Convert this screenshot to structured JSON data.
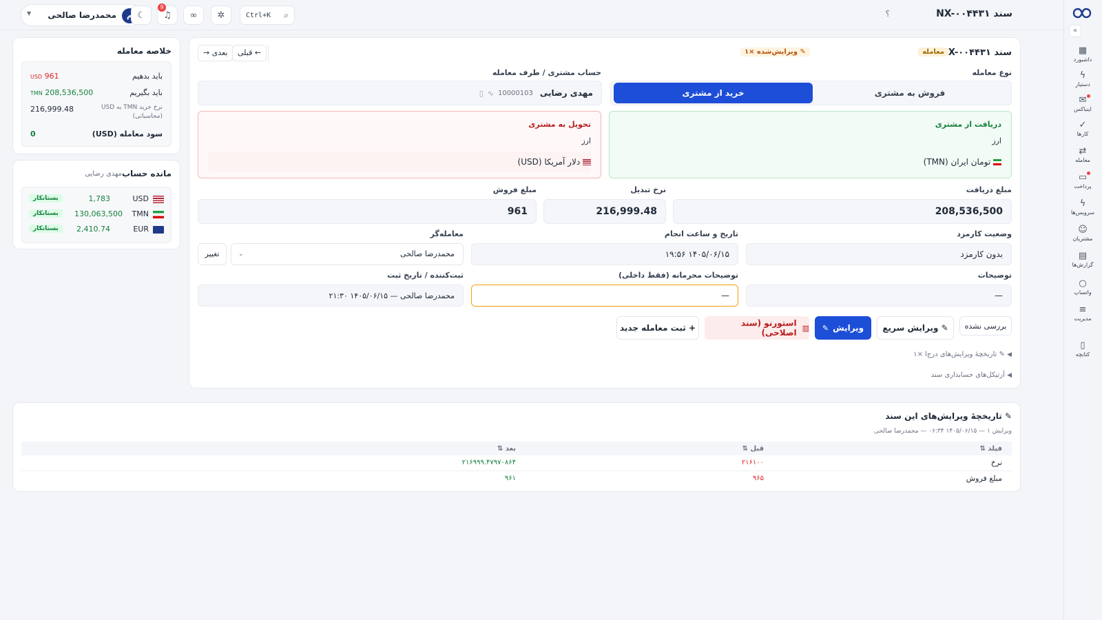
{
  "header": {
    "doc_title": "سند NX-۰۰۴۴۳۱",
    "help": "؟",
    "search_shortcut": "Ctrl+K",
    "notification_count": "9",
    "user_name": "محمدرضا صالحی",
    "user_initial": "م"
  },
  "sidebar": {
    "items": [
      {
        "label": "داشبورد",
        "icon": "▦"
      },
      {
        "label": "دستیار",
        "icon": "ϟ"
      },
      {
        "label": "اینباکس",
        "icon": "✉"
      },
      {
        "label": "کارها",
        "icon": "✓"
      },
      {
        "label": "معامله",
        "icon": "⇄"
      },
      {
        "label": "پرداخت",
        "icon": "▭"
      },
      {
        "label": "سرویس‌ها",
        "icon": "ϟ"
      },
      {
        "label": "مشتریان",
        "icon": "☺"
      },
      {
        "label": "گزارش‌ها",
        "icon": "▤"
      },
      {
        "label": "واتساپ",
        "icon": "○"
      },
      {
        "label": "مدیریت",
        "icon": "≡"
      },
      {
        "label": "کتابچه",
        "icon": "▯"
      }
    ]
  },
  "doc": {
    "title": "سند NX-۰۰۴۴۳۱",
    "type_badge": "معامله",
    "edited_badge": "✎ ویرایش‌شده ×۱",
    "prev": "← قبلی",
    "next": "بعدی →",
    "trade_type_label": "نوع معامله",
    "sell_label": "فروش به مشتری",
    "buy_label": "خرید از مشتری",
    "account_label": "حساب مشتری / طرف معامله",
    "account_name": "مهدی رضایی",
    "account_id": "10000103",
    "receive_title": "دریافت از مشتری",
    "receive_currency_label": "ارز",
    "receive_currency": "تومان ایران (TMN)",
    "deliver_title": "تحویل به مشتری",
    "deliver_currency_label": "ارز",
    "deliver_currency": "دلار آمریکا (USD)",
    "receive_amount_label": "مبلغ دریافت",
    "receive_amount": "208,536,500",
    "rate_label": "نرخ تبدیل",
    "rate": "216,999.48",
    "sell_amount_label": "مبلغ فروش",
    "sell_amount": "961",
    "fee_label": "وضعیت کارمزد",
    "fee": "بدون کارمزد",
    "datetime_label": "تاریخ و ساعت انجام",
    "datetime": "۱۴۰۵/۰۶/۱۵ ۱۹:۵۶",
    "dealer_label": "معامله‌گر",
    "dealer": "محمدرضا صالحی",
    "change": "تغییر",
    "notes_label": "توضیحات",
    "notes": "—",
    "private_notes_label": "توضیحات محرمانه (فقط داخلی)",
    "private_notes": "—",
    "registrar_label": "ثبت‌کننده / تاریخ ثبت",
    "registrar": "محمدرضا صالحی — ۱۴۰۵/۰۶/۱۵ ۲۱:۳۰",
    "status": "بررسی نشده",
    "quick_edit": "✎ ویرایش سریع",
    "edit": "ویرایش",
    "reverse": "استورنو (سند اصلاحی)",
    "new_trade": "+ ثبت معامله جدید",
    "history_toggle": "✎ تاریخچهٔ ویرایش‌های درج‌ا ×۱",
    "journal_toggle": "آرتیکل‌های حسابداری سند"
  },
  "summary": {
    "title": "خلاصه معامله",
    "pay_label": "باید بدهیم",
    "pay_value": "961",
    "pay_cur": "USD",
    "get_label": "باید بگیریم",
    "get_value": "208,536,500",
    "get_cur": "TMN",
    "rate_label": "نرخ خرید TMN به USD (محاسباتی)",
    "rate_value": "216,999.48",
    "profit_label": "سود معامله (USD)",
    "profit_value": "0"
  },
  "balance": {
    "title": "مانده حساب",
    "owner": "مهدی رضایی",
    "rows": [
      {
        "cur": "USD",
        "amount": "1,783",
        "status": "بستانکار"
      },
      {
        "cur": "TMN",
        "amount": "130,063,500",
        "status": "بستانکار"
      },
      {
        "cur": "EUR",
        "amount": "2,410.74",
        "status": "بستانکار"
      }
    ]
  },
  "history": {
    "title": "✎ تاریخچهٔ ویرایش‌های این سند",
    "meta": "ویرایش ۱ — ۱۴۰۵/۰۶/۱۵ ۰۶:۳۴ — محمدرضا صالحی",
    "columns": [
      "فیلد ⇅",
      "قبل ⇅",
      "بعد ⇅"
    ],
    "rows": [
      [
        "نرخ",
        "۲۱۶۱۰۰",
        "۲۱۶۹۹۹.۴۷۹۷۰۸۶۴"
      ],
      [
        "مبلغ فروش",
        "۹۶۵",
        "۹۶۱"
      ]
    ]
  },
  "colors": {
    "primary": "#1d4ed8",
    "green": "#16a34a",
    "red": "#dc2626",
    "orange": "#f59e0b"
  }
}
